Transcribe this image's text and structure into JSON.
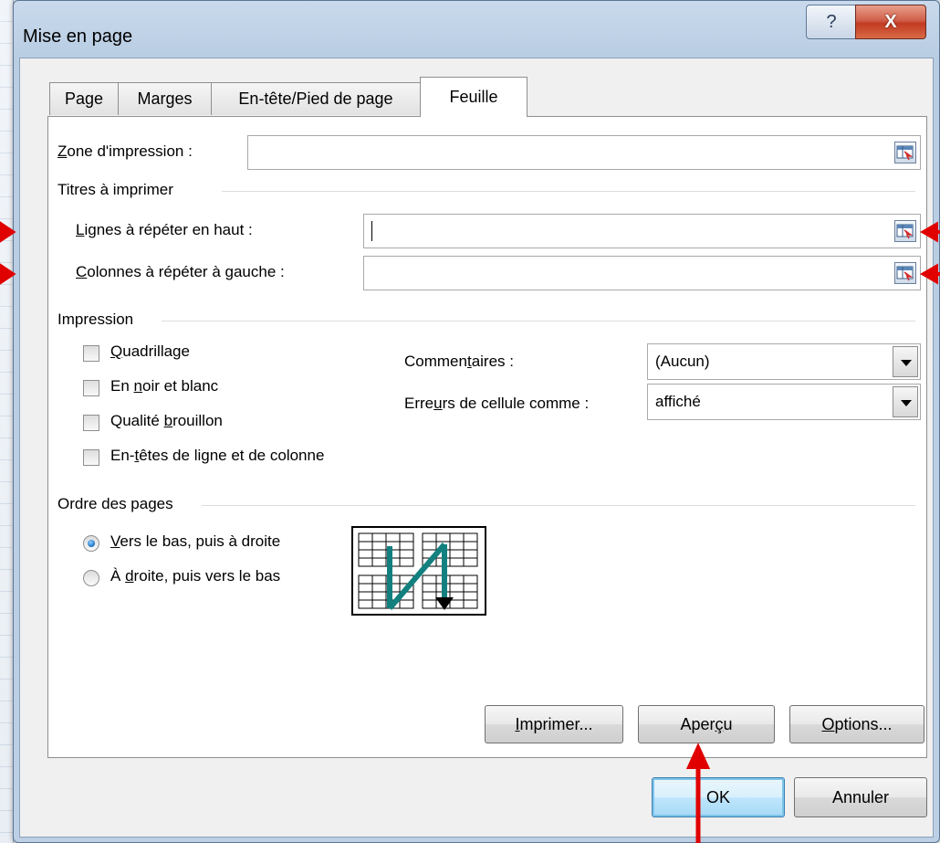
{
  "window": {
    "title": "Mise en page",
    "help_glyph": "?",
    "close_glyph": "X"
  },
  "tabs": [
    {
      "label": "Page",
      "active": false
    },
    {
      "label": "Marges",
      "active": false
    },
    {
      "label": "En-tête/Pied de page",
      "active": false
    },
    {
      "label": "Feuille",
      "active": true
    }
  ],
  "print_area": {
    "label_mnemonic": "Z",
    "label_rest": "one d'impression :",
    "value": ""
  },
  "titles_group": {
    "title": "Titres à imprimer",
    "rows_label_mnemonic": "L",
    "rows_label_rest": "ignes à répéter en haut :",
    "rows_value": "",
    "cols_label_mnemonic": "C",
    "cols_label_rest": "olonnes à répéter à gauche :",
    "cols_value": ""
  },
  "print_group": {
    "title": "Impression",
    "checkboxes": [
      {
        "pre": "",
        "mnemonic": "Q",
        "post": "uadrillage",
        "checked": false
      },
      {
        "pre": "En ",
        "mnemonic": "n",
        "post": "oir et blanc",
        "checked": false
      },
      {
        "pre": "Qualité ",
        "mnemonic": "b",
        "post": "rouillon",
        "checked": false
      },
      {
        "pre": "En-",
        "mnemonic": "t",
        "post": "êtes de ligne et de colonne",
        "checked": false
      }
    ],
    "comments_label_pre": "Commen",
    "comments_label_mnemonic": "t",
    "comments_label_post": "aires :",
    "comments_value": "(Aucun)",
    "errors_label_pre": "Erre",
    "errors_label_mnemonic": "u",
    "errors_label_post": "rs de cellule comme :",
    "errors_value": "affiché"
  },
  "order_group": {
    "title": "Ordre des pages",
    "option_down_mnemonic": "V",
    "option_down_rest": "ers le bas, puis à droite",
    "option_down_selected": true,
    "option_over_pre": "À ",
    "option_over_mnemonic": "d",
    "option_over_post": "roite, puis vers le bas",
    "option_over_selected": false
  },
  "buttons": {
    "print_mnemonic": "I",
    "print_rest": "mprimer...",
    "preview_pre": "Aper",
    "preview_mnemonic": "ç",
    "preview_post": "u",
    "options_mnemonic": "O",
    "options_rest": "ptions...",
    "ok": "OK",
    "cancel": "Annuler"
  },
  "colors": {
    "annotation_red": "#e00000",
    "arrow_teal": "#12807f"
  }
}
